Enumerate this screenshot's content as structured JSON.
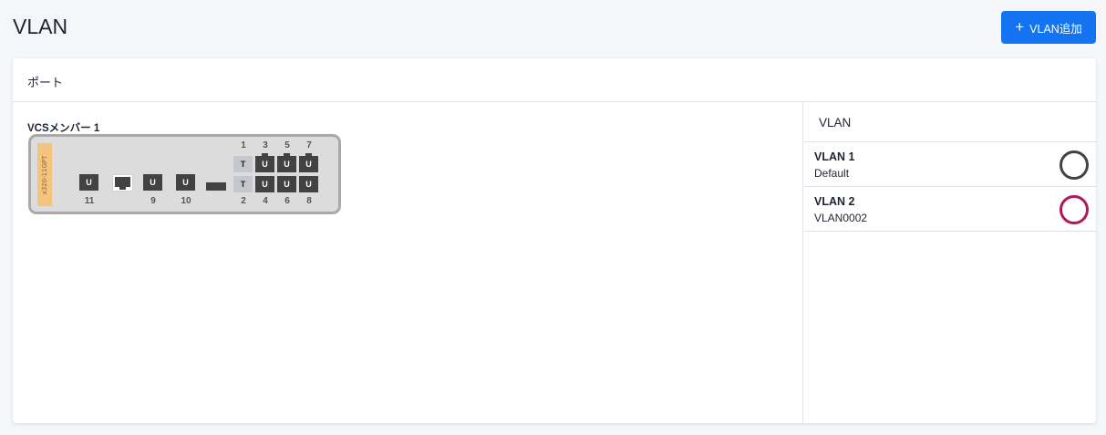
{
  "page": {
    "title": "VLAN"
  },
  "toolbar": {
    "add_label": "VLAN追加",
    "add_icon": "+"
  },
  "card": {
    "header": "ポート"
  },
  "switch": {
    "member_title": "VCSメンバー 1",
    "model": "x320-11GPT",
    "ports": [
      {
        "num": "11",
        "mode": "U"
      },
      {
        "num": "9",
        "mode": "U"
      },
      {
        "num": "10",
        "mode": "U"
      },
      {
        "num": "1",
        "mode": "T"
      },
      {
        "num": "2",
        "mode": "T"
      },
      {
        "num": "3",
        "mode": "U"
      },
      {
        "num": "4",
        "mode": "U"
      },
      {
        "num": "5",
        "mode": "U"
      },
      {
        "num": "6",
        "mode": "U"
      },
      {
        "num": "7",
        "mode": "U"
      },
      {
        "num": "8",
        "mode": "U"
      }
    ]
  },
  "vlan_panel": {
    "title": "VLAN",
    "items": [
      {
        "name": "VLAN 1",
        "desc": "Default",
        "color": "#424242"
      },
      {
        "name": "VLAN 2",
        "desc": "VLAN0002",
        "color": "#b0185a"
      }
    ]
  },
  "colors": {
    "accent": "#1473f0",
    "port_untagged": "#424242",
    "port_tagged": "#c4c8cc"
  }
}
